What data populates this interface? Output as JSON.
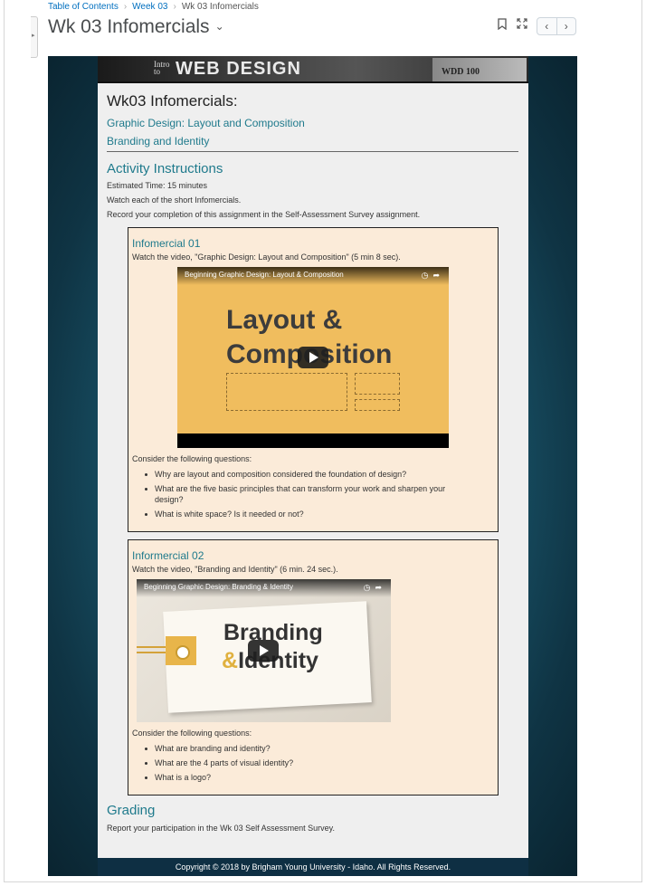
{
  "breadcrumb": {
    "items": [
      "Table of Contents",
      "Week 03",
      "Wk 03  Infomercials"
    ]
  },
  "header": {
    "title": "Wk 03  Infomercials",
    "icons": [
      "bookmark-icon",
      "fullscreen-icon",
      "chevron-left-icon",
      "chevron-right-icon"
    ]
  },
  "banner": {
    "intro": "Intro to",
    "title": "WEB DESIGN",
    "code": "WDD 100"
  },
  "page": {
    "heading": "Wk03  Infomercials:",
    "links": [
      "Graphic Design: Layout and Composition",
      "Branding and Identity"
    ],
    "activity_heading": "Activity Instructions",
    "instructions": [
      "Estimated Time: 15 minutes",
      "Watch each of the short Infomercials.",
      "Record your completion of this assignment in the Self-Assessment Survey assignment."
    ],
    "infomercials": [
      {
        "title": "Infomercial 01",
        "description": "Watch the video, \"Graphic Design: Layout and Composition\" (5 min 8 sec).",
        "video_title": "Beginning Graphic Design: Layout & Composition",
        "video_text_line1": "Layout &",
        "video_text_line2": "Composition",
        "questions_intro": "Consider the following questions:",
        "questions": [
          "Why are layout and composition considered the foundation of design?",
          "What are the five basic principles that can transform your work and sharpen your design?",
          "What is white space?  Is it needed or not?"
        ]
      },
      {
        "title": "Informercial 02",
        "description": "Watch the video, \"Branding and Identity\" (6 min. 24 sec.).",
        "video_title": "Beginning Graphic Design: Branding & Identity",
        "video_text_line1": "Branding",
        "video_text_amp": "&",
        "video_text_line2": "Identity",
        "questions_intro": "Consider the following questions:",
        "questions": [
          "What are branding and identity?",
          "What are the 4 parts of visual identity?",
          "What is a logo?"
        ]
      }
    ],
    "grading_heading": "Grading",
    "grading_text": "Report your participation in the Wk 03 Self Assessment Survey.",
    "footer": "Copyright © 2018 by Brigham Young University - Idaho. All Rights Reserved."
  },
  "colors": {
    "accent": "#1f7a8c",
    "box_bg": "#fbebd9",
    "footer_bg": "#0e2f43",
    "video1_bg": "#f0bd5e"
  }
}
